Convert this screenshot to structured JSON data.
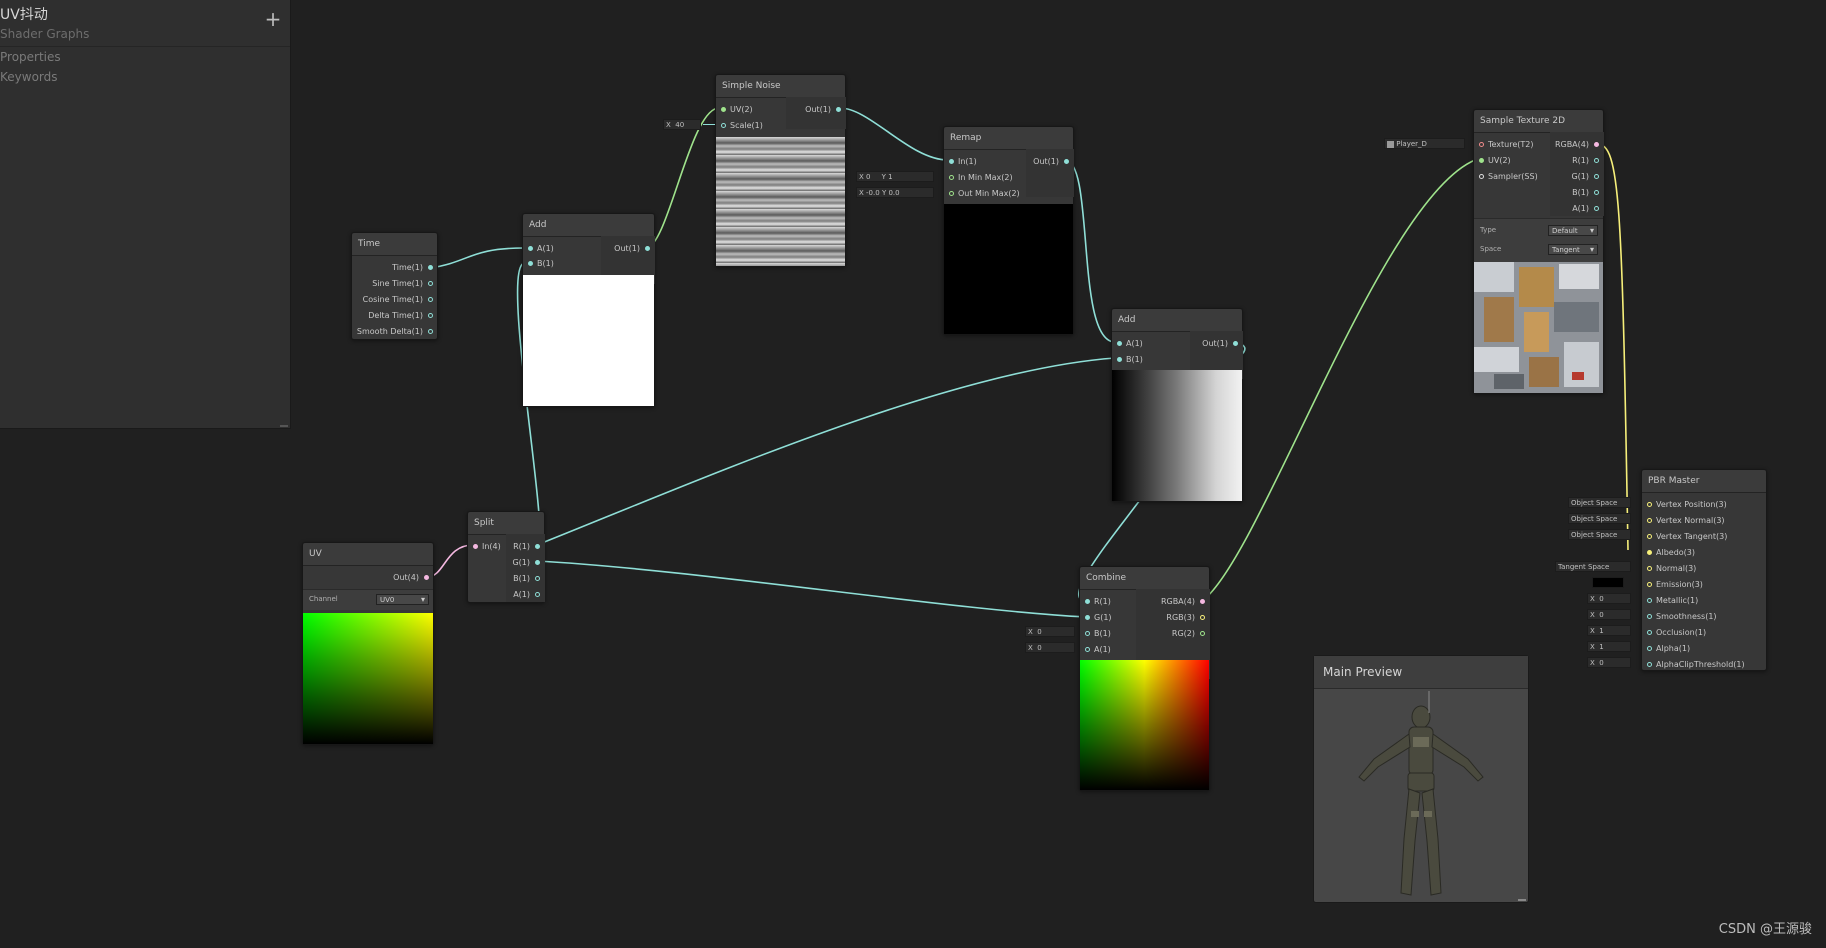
{
  "blackboard": {
    "title": "UV抖动",
    "subtitle": "Shader Graphs",
    "add_label": "+",
    "sections": [
      "Properties",
      "Keywords"
    ]
  },
  "nodes": {
    "time": {
      "title": "Time",
      "outputs": [
        "Time(1)",
        "Sine Time(1)",
        "Cosine Time(1)",
        "Delta Time(1)",
        "Smooth Delta(1)"
      ]
    },
    "add1": {
      "title": "Add",
      "inputs": [
        "A(1)",
        "B(1)"
      ],
      "output": "Out(1)"
    },
    "simple_noise": {
      "title": "Simple Noise",
      "inputs": [
        "UV(2)",
        "Scale(1)"
      ],
      "output": "Out(1)",
      "scale_axis": "X",
      "scale_value": "40"
    },
    "remap": {
      "title": "Remap",
      "inputs": [
        "In(1)",
        "In Min Max(2)",
        "Out Min Max(2)"
      ],
      "output": "Out(1)",
      "in_min_x": "0",
      "in_min_y": "1",
      "out_min_x": "-0.0",
      "out_min_y": "0.0"
    },
    "add2": {
      "title": "Add",
      "inputs": [
        "A(1)",
        "B(1)"
      ],
      "output": "Out(1)"
    },
    "uv": {
      "title": "UV",
      "output": "Out(4)",
      "channel_label": "Channel",
      "channel_value": "UV0"
    },
    "split": {
      "title": "Split",
      "input": "In(4)",
      "outputs": [
        "R(1)",
        "G(1)",
        "B(1)",
        "A(1)"
      ]
    },
    "combine": {
      "title": "Combine",
      "inputs": [
        "R(1)",
        "G(1)",
        "B(1)",
        "A(1)"
      ],
      "outputs": [
        "RGBA(4)",
        "RGB(3)",
        "RG(2)"
      ],
      "b_value": "0",
      "a_value": "0"
    },
    "sample_texture": {
      "title": "Sample Texture 2D",
      "inputs": [
        "Texture(T2)",
        "UV(2)",
        "Sampler(SS)"
      ],
      "outputs": [
        "RGBA(4)",
        "R(1)",
        "G(1)",
        "B(1)",
        "A(1)"
      ],
      "texture_field": "Player_D",
      "type_label": "Type",
      "type_value": "Default",
      "space_label": "Space",
      "space_value": "Tangent"
    },
    "pbr_master": {
      "title": "PBR Master",
      "inputs": [
        "Vertex Position(3)",
        "Vertex Normal(3)",
        "Vertex Tangent(3)",
        "Albedo(3)",
        "Normal(3)",
        "Emission(3)",
        "Metallic(1)",
        "Smoothness(1)",
        "Occlusion(1)",
        "Alpha(1)",
        "AlphaClipThreshold(1)"
      ],
      "object_space": "Object Space",
      "tangent_space": "Tangent Space",
      "metallic": "0",
      "smoothness": "0",
      "occlusion": "1",
      "alpha": "1",
      "alpha_clip": "0"
    }
  },
  "axis_x": "X",
  "axis_y": "Y",
  "main_preview": {
    "title": "Main Preview"
  },
  "watermark": "CSDN @王源骏",
  "colors": {
    "canvas": "#202020",
    "node": "#373737",
    "float_wire": "#8fdfd7",
    "vector4_wire": "#f4b8e0",
    "vector2_wire": "#9fe38c",
    "vector3_wire": "#f6ef7a"
  }
}
